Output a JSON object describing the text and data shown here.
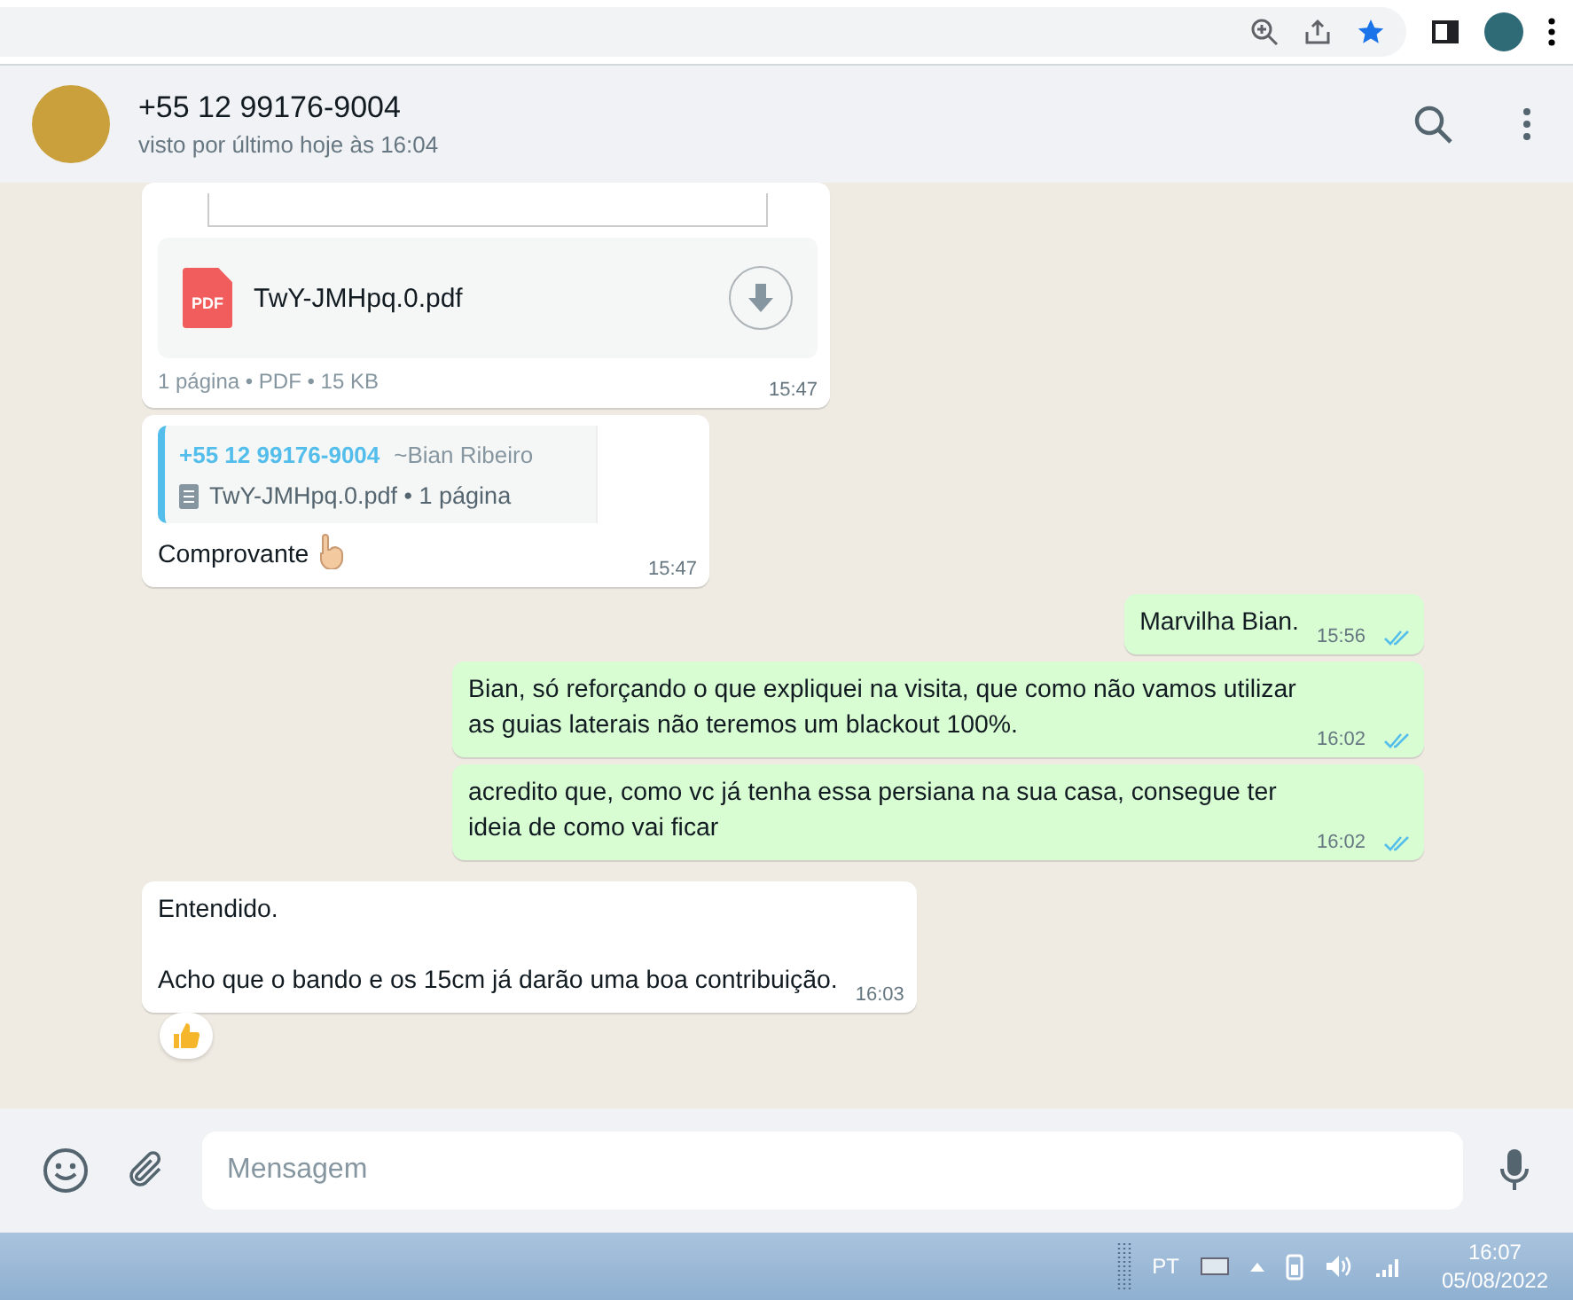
{
  "chat_header": {
    "name": "+55 12 99176-9004",
    "status": "visto por último hoje às 16:04"
  },
  "messages": [
    {
      "kind": "document",
      "file_name": "TwY-JMHpq.0.pdf",
      "file_type": "PDF",
      "meta": "1 página • PDF • 15 KB",
      "time": "15:47"
    },
    {
      "kind": "reply",
      "quote_sender": "+55 12 99176-9004",
      "quote_author": "~Bian Ribeiro",
      "quote_text": "TwY-JMHpq.0.pdf • 1 página",
      "text": "Comprovante",
      "time": "15:47"
    },
    {
      "kind": "outgoing",
      "text": "Marvilha Bian.",
      "time": "15:56",
      "read": true
    },
    {
      "kind": "outgoing",
      "text": "Bian, só reforçando o que expliquei na visita, que como não vamos utilizar as guias laterais não teremos um blackout 100%.",
      "time": "16:02",
      "read": true
    },
    {
      "kind": "outgoing",
      "text": "acredito que, como vc já tenha essa persiana na sua casa, consegue ter ideia de como vai ficar",
      "time": "16:02",
      "read": true
    },
    {
      "kind": "incoming",
      "text": "Entendido.\n\nAcho que o bando e os 15cm já darão uma boa contribuição.",
      "time": "16:03",
      "reacted": true
    }
  ],
  "composer": {
    "placeholder": "Mensagem"
  },
  "taskbar": {
    "language": "PT",
    "time": "16:07",
    "date": "05/08/2022"
  }
}
